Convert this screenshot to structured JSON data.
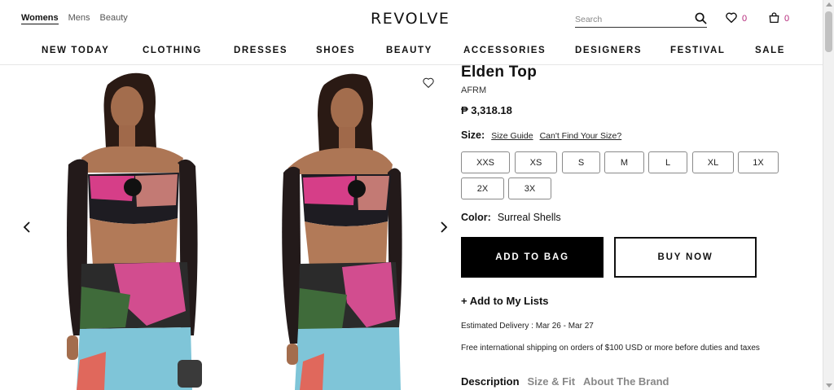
{
  "header": {
    "gender_tabs": [
      "Womens",
      "Mens",
      "Beauty"
    ],
    "logo": "REVOLVE",
    "search_placeholder": "Search",
    "wishlist_count": "0",
    "bag_count": "0"
  },
  "nav": [
    "NEW TODAY",
    "CLOTHING",
    "DRESSES",
    "SHOES",
    "BEAUTY",
    "ACCESSORIES",
    "DESIGNERS",
    "FESTIVAL",
    "SALE"
  ],
  "product": {
    "title": "Elden Top",
    "brand": "AFRM",
    "price": "₱ 3,318.18",
    "size_label": "Size:",
    "size_guide": "Size Guide",
    "cant_find_size": "Can't Find Your Size?",
    "sizes": [
      "XXS",
      "XS",
      "S",
      "M",
      "L",
      "XL",
      "1X",
      "2X",
      "3X"
    ],
    "color_label": "Color:",
    "color_value": "Surreal Shells",
    "add_to_bag": "ADD TO BAG",
    "buy_now": "BUY NOW",
    "add_to_lists": "+ Add to My Lists",
    "delivery": "Estimated Delivery : Mar 26 - Mar 27",
    "shipping": "Free international shipping on orders of $100 USD or more before duties and taxes"
  },
  "tabs": [
    "Description",
    "Size & Fit",
    "About The Brand"
  ],
  "colors": {
    "accent": "#b4287a",
    "primary_button": "#000000"
  }
}
